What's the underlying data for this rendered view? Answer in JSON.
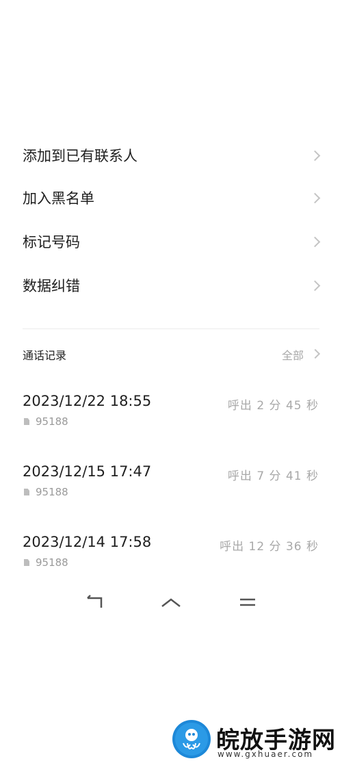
{
  "menu": {
    "items": [
      {
        "label": "添加到已有联系人"
      },
      {
        "label": "加入黑名单"
      },
      {
        "label": "标记号码"
      },
      {
        "label": "数据纠错"
      }
    ]
  },
  "call_log": {
    "title": "通话记录",
    "all_label": "全部",
    "entries": [
      {
        "time": "2023/12/22 18:55",
        "number": "95188",
        "duration": "呼出 2 分 45 秒"
      },
      {
        "time": "2023/12/15 17:47",
        "number": "95188",
        "duration": "呼出 7 分 41 秒"
      },
      {
        "time": "2023/12/14 17:58",
        "number": "95188",
        "duration": "呼出 12 分 36 秒"
      }
    ]
  },
  "navbar": {
    "icons": [
      "back-icon",
      "home-icon",
      "menu-icon"
    ]
  },
  "watermark": {
    "name": "皖放手游网",
    "url": "www.gxhuaer.com"
  },
  "colors": {
    "logo": "#1d88d8",
    "secondary_text": "#a8a8a8"
  }
}
